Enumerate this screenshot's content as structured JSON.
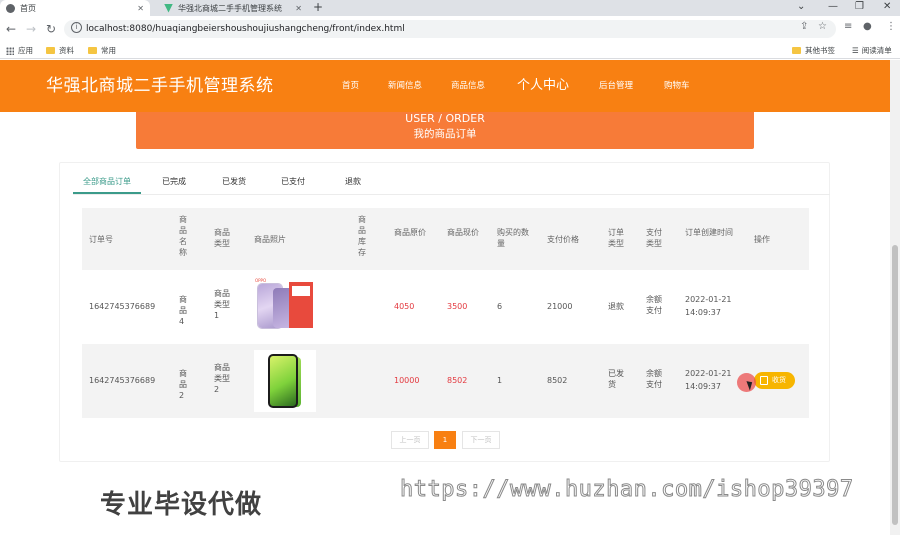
{
  "browser": {
    "tabs": [
      {
        "title": "首页",
        "active": true
      },
      {
        "title": "华强北商城二手手机管理系统",
        "active": false
      }
    ],
    "url": "localhost:8080/huaqiangbeiershoushoujiushangcheng/front/index.html",
    "bookmarks": [
      "应用",
      "资料",
      "常用"
    ],
    "bookmarks_right": [
      "其他书签",
      "阅读清单"
    ]
  },
  "site": {
    "title": "华强北商城二手手机管理系统",
    "nav": [
      "首页",
      "新闻信息",
      "商品信息",
      "个人中心",
      "后台管理",
      "购物车"
    ]
  },
  "banner": {
    "en": "USER / ORDER",
    "cn": "我的商品订单"
  },
  "order_tabs": [
    "全部商品订单",
    "已完成",
    "已发货",
    "已支付",
    "退款"
  ],
  "table": {
    "headers": [
      "订单号",
      "商品名称",
      "商品类型",
      "商品照片",
      "商品库存",
      "商品原价",
      "商品现价",
      "购买的数量",
      "支付价格",
      "订单类型",
      "支付类型",
      "订单创建时间",
      "操作"
    ],
    "rows": [
      {
        "order_no": "1642745376689",
        "name": "商品4",
        "type": "商品类型1",
        "stock": "",
        "orig_price": "4050",
        "cur_price": "3500",
        "qty": "6",
        "pay_price": "21000",
        "order_type": "退款",
        "pay_type": "余额支付",
        "created_date": "2022-01-21",
        "created_time": "14:09:37",
        "action": ""
      },
      {
        "order_no": "1642745376689",
        "name": "商品2",
        "type": "商品类型2",
        "stock": "",
        "orig_price": "10000",
        "cur_price": "8502",
        "qty": "1",
        "pay_price": "8502",
        "order_type": "已发货",
        "pay_type": "余额支付",
        "created_date": "2022-01-21",
        "created_time": "14:09:37",
        "action": "收货"
      }
    ]
  },
  "pagination": {
    "prev": "上一页",
    "current": "1",
    "next": "下一页"
  },
  "watermark": {
    "cn": "专业毕设代做",
    "url": "https://www.huzhan.com/ishop39397"
  },
  "colors": {
    "header": "#f88012",
    "banner": "#f77b38",
    "accent": "#3b9b8a",
    "price": "#e3393f",
    "pay_button": "#f7b500"
  }
}
